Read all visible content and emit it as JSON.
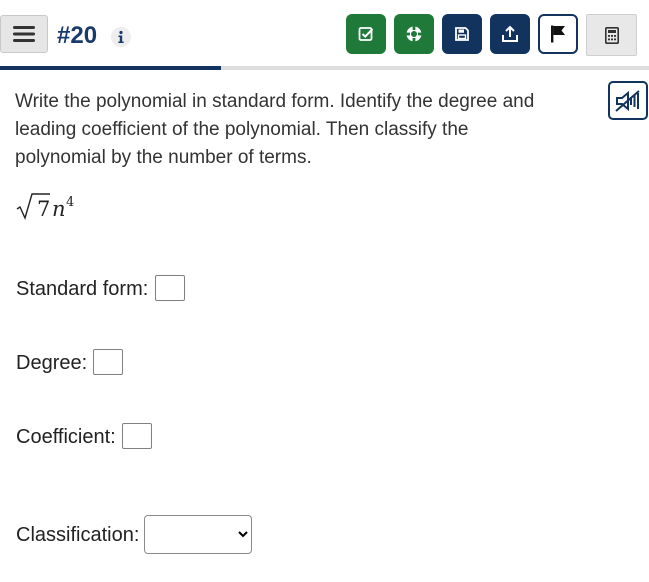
{
  "header": {
    "question_number": "#20",
    "menu_icon": "hamburger-menu-icon",
    "info_icon": "info-icon",
    "toolbar": [
      {
        "name": "check-answer",
        "icon": "checkbox-check-icon",
        "color": "#1f7a3a"
      },
      {
        "name": "help",
        "icon": "lifebuoy-icon",
        "color": "#1f7a3a"
      },
      {
        "name": "save",
        "icon": "save-disk-icon",
        "color": "#12335e"
      },
      {
        "name": "submit",
        "icon": "upload-icon",
        "color": "#12335e"
      },
      {
        "name": "flag",
        "icon": "flag-icon",
        "color": "#12335e"
      }
    ],
    "calculator_icon": "calculator-icon"
  },
  "progress": {
    "fraction": 0.34,
    "fill_color": "#12335e",
    "track_color": "#dedede"
  },
  "audio": {
    "icon": "mute-speaker-icon"
  },
  "question": {
    "prompt": "Write the polynomial in standard form. Identify the degree and leading coefficient of the polynomial. Then classify the polynomial by the number of terms.",
    "expression": {
      "radicand": "7",
      "variable": "n",
      "exponent": "4"
    }
  },
  "fields": {
    "standard_form": {
      "label": "Standard form:",
      "value": ""
    },
    "degree": {
      "label": "Degree:",
      "value": ""
    },
    "coefficient": {
      "label": "Coefficient:",
      "value": ""
    },
    "classification": {
      "label": "Classification:",
      "selected": ""
    }
  }
}
